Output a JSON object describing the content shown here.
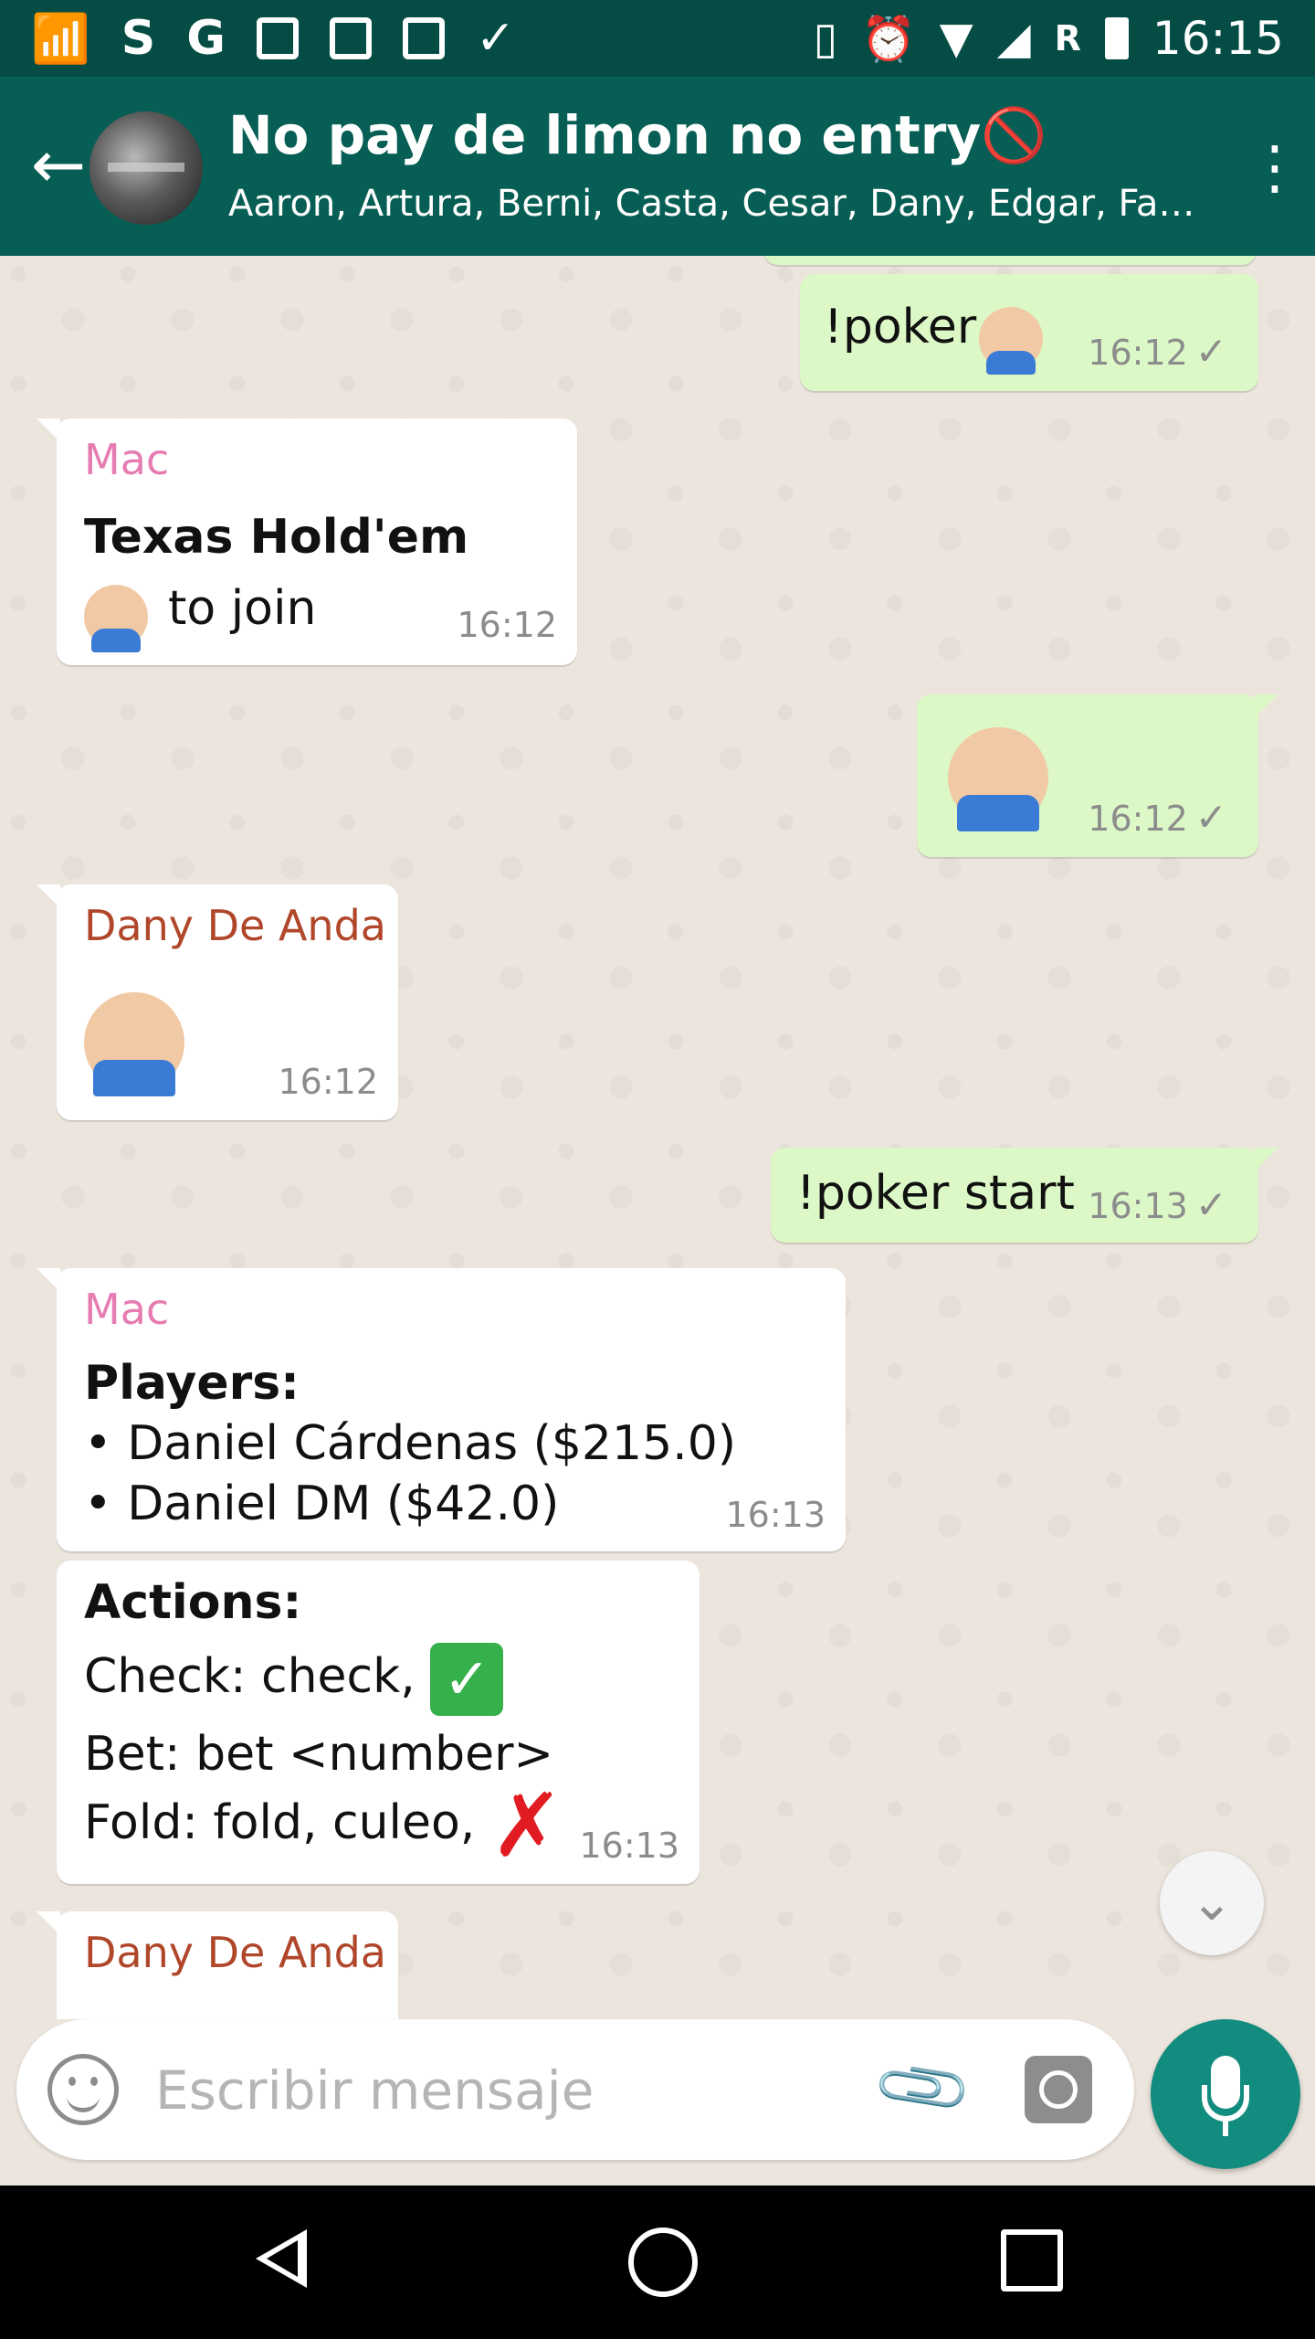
{
  "status_bar": {
    "time": "16:15",
    "network_letter": "R",
    "left_icons": [
      "cast-icon",
      "s-app-icon",
      "google-icon",
      "calendar-icon",
      "contact-icon",
      "image-icon",
      "check-icon"
    ],
    "right_icons": [
      "vibrate-icon",
      "alarm-icon",
      "wifi-icon",
      "signal-icon",
      "battery-icon"
    ]
  },
  "header": {
    "title": "No pay de limon no entry🚫",
    "subtitle": "Aaron, Artura, Berni, Casta, Cesar, Dany, Edgar, Fab…",
    "colors": {
      "appbar": "#075e54",
      "statusbar": "#054d44"
    }
  },
  "messages": [
    {
      "id": "m1",
      "direction": "out",
      "text": "!poker",
      "time": "16:12"
    },
    {
      "id": "m2",
      "direction": "in",
      "sender": "Mac",
      "line1": "Texas Hold'em",
      "line2": "to join",
      "time": "16:12"
    },
    {
      "id": "m3",
      "direction": "out",
      "time": "16:12"
    },
    {
      "id": "m4",
      "direction": "in",
      "sender": "Dany De Anda",
      "time": "16:12"
    },
    {
      "id": "m5",
      "direction": "out",
      "text": "!poker start",
      "time": "16:13"
    },
    {
      "id": "m6",
      "direction": "in",
      "sender": "Mac",
      "heading": "Players:",
      "line1": "• Daniel Cárdenas ($215.0)",
      "line2": "• Daniel DM ($42.0)",
      "time": "16:13"
    },
    {
      "id": "m7",
      "direction": "in",
      "heading": "Actions:",
      "line1": "Check: check,",
      "line2": "Bet: bet <number>",
      "line3": "Fold: fold, culeo,",
      "time": "16:13"
    },
    {
      "id": "m8",
      "direction": "in",
      "sender": "Dany De Anda"
    }
  ],
  "input": {
    "placeholder": "Escribir mensaje"
  },
  "tick_glyph": "✓",
  "colors": {
    "incoming_bubble": "#ffffff",
    "outgoing_bubble": "#dcf8c6",
    "mac_name": "#e67cb1",
    "dany_name": "#b0472a",
    "fab": "#128c7e"
  }
}
